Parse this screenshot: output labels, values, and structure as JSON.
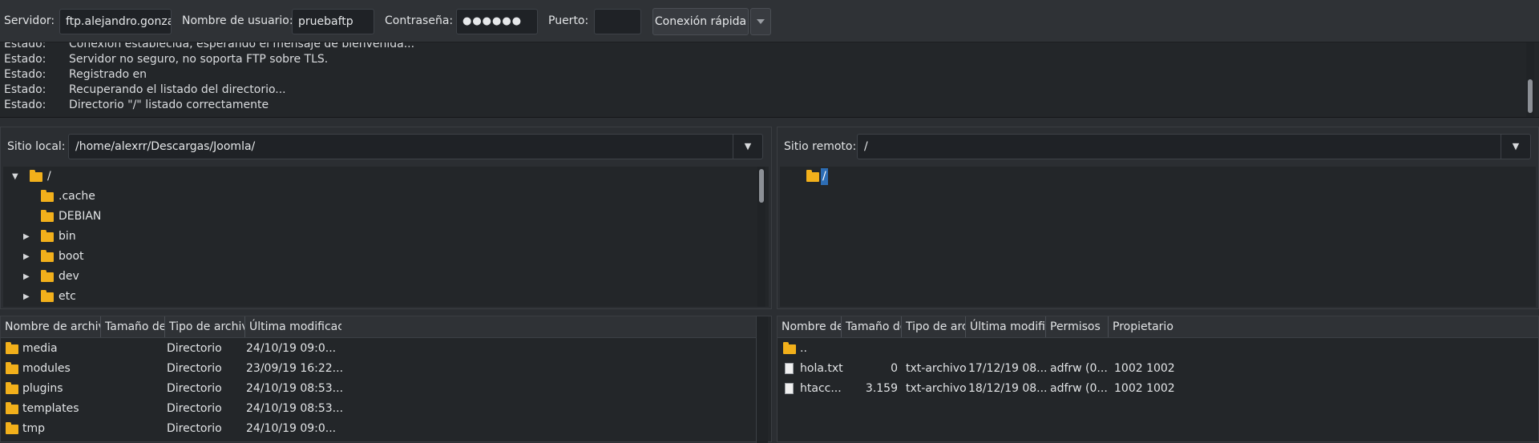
{
  "quickconnect": {
    "server_label": "Servidor:",
    "server_value": "ftp.alejandro.gonza",
    "user_label": "Nombre de usuario:",
    "user_value": "pruebaftp",
    "password_label": "Contraseña:",
    "password_value": "●●●●●●",
    "port_label": "Puerto:",
    "port_value": "",
    "connect_button": "Conexión rápida",
    "dropdown_icon": "chevron-down-icon"
  },
  "log": [
    {
      "key": "Estado:",
      "text": "Conexión establecida, esperando el mensaje de bienvenida..."
    },
    {
      "key": "Estado:",
      "text": "Servidor no seguro, no soporta FTP sobre TLS."
    },
    {
      "key": "Estado:",
      "text": "Registrado en"
    },
    {
      "key": "Estado:",
      "text": "Recuperando el listado del directorio..."
    },
    {
      "key": "Estado:",
      "text": "Directorio \"/\" listado correctamente"
    }
  ],
  "local": {
    "site_label": "Sitio local:",
    "path": "/home/alexrr/Descargas/Joomla/",
    "tree": [
      {
        "name": "/",
        "arrow": "▼"
      },
      {
        "name": ".cache",
        "arrow": ""
      },
      {
        "name": "DEBIAN",
        "arrow": ""
      },
      {
        "name": "bin",
        "arrow": "▶"
      },
      {
        "name": "boot",
        "arrow": "▶"
      },
      {
        "name": "dev",
        "arrow": "▶"
      },
      {
        "name": "etc",
        "arrow": "▶"
      }
    ],
    "columns": [
      "Nombre de archivo",
      "Tamaño de archivo",
      "Tipo de archivo",
      "Última modificación"
    ],
    "files": [
      {
        "name": "media",
        "size": "",
        "type": "Directorio",
        "modified": "24/10/19 09:0..."
      },
      {
        "name": "modules",
        "size": "",
        "type": "Directorio",
        "modified": "23/09/19 16:22..."
      },
      {
        "name": "plugins",
        "size": "",
        "type": "Directorio",
        "modified": "24/10/19 08:53..."
      },
      {
        "name": "templates",
        "size": "",
        "type": "Directorio",
        "modified": "24/10/19 08:53..."
      },
      {
        "name": "tmp",
        "size": "",
        "type": "Directorio",
        "modified": "24/10/19 09:0..."
      }
    ]
  },
  "remote": {
    "site_label": "Sitio remoto:",
    "path": "/",
    "tree": [
      {
        "name": "/",
        "selected": true
      }
    ],
    "columns": [
      "Nombre de archivo",
      "Tamaño de archivo",
      "Tipo de archivo",
      "Última modificación",
      "Permisos",
      "Propietario"
    ],
    "files": [
      {
        "name": "..",
        "size": "",
        "type": "",
        "modified": "",
        "perms": "",
        "owner": "",
        "icon": "folder-icon"
      },
      {
        "name": "hola.txt",
        "size": "0",
        "type": "txt-archivo",
        "modified": "17/12/19 08...",
        "perms": "adfrw (0...",
        "owner": "1002 1002",
        "icon": "file-icon"
      },
      {
        "name": "htacc...",
        "size": "3.159",
        "type": "txt-archivo",
        "modified": "18/12/19 08...",
        "perms": "adfrw (0...",
        "owner": "1002 1002",
        "icon": "file-icon"
      }
    ]
  }
}
